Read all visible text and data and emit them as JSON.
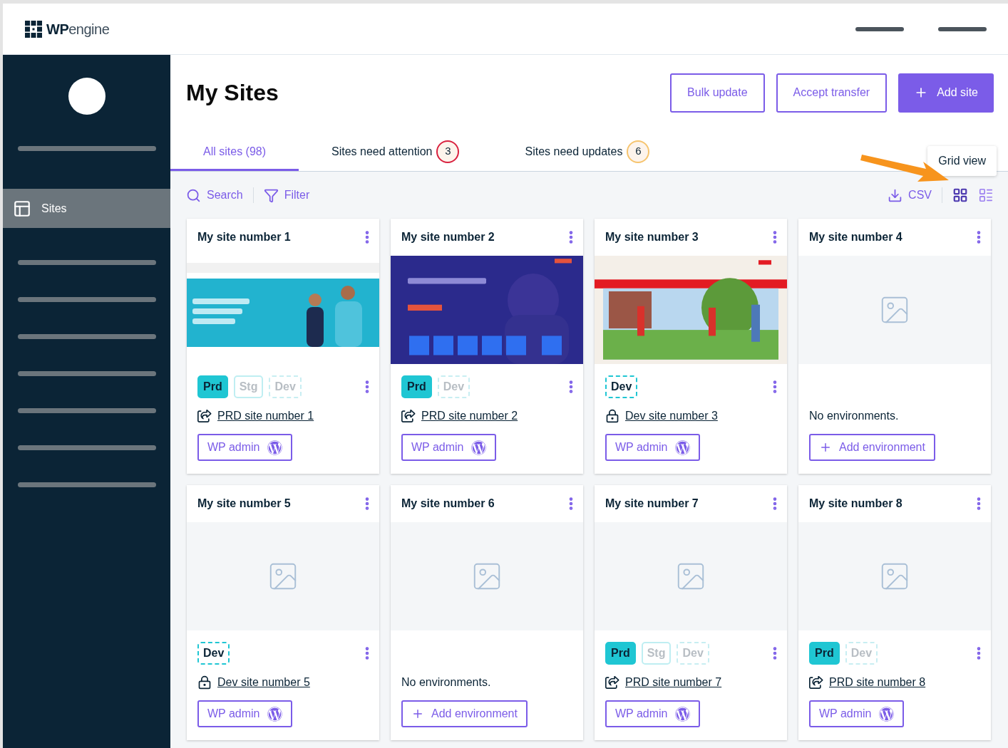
{
  "logo": {
    "bold": "WP",
    "light": "engine"
  },
  "sidebar": {
    "items": [
      {
        "label": "Sites",
        "selected": true
      }
    ]
  },
  "page_title": "My Sites",
  "header_buttons": [
    {
      "label": "Bulk update",
      "kind": "outline"
    },
    {
      "label": "Accept transfer",
      "kind": "outline"
    },
    {
      "label": "Add site",
      "kind": "primary"
    }
  ],
  "tabs": [
    {
      "label": "All sites (98)",
      "selected": true
    },
    {
      "label": "Sites need attention",
      "badge": "3",
      "color": "#d9213f",
      "selected": false
    },
    {
      "label": "Sites need updates",
      "badge": "6",
      "color": "#f6c46e",
      "selected": false
    }
  ],
  "toolbar": {
    "search": "Search",
    "filter": "Filter",
    "export": "CSV",
    "views": [
      {
        "kind": "grid",
        "selected": true
      },
      {
        "kind": "list",
        "selected": false
      }
    ],
    "tooltip": "Grid view"
  },
  "cards": [
    {
      "title": "My site number 1",
      "thumbnail": {
        "kind": "picture"
      },
      "environments": [
        {
          "label": "Prd",
          "kind": "prd",
          "selected": true
        },
        {
          "label": "Stg",
          "kind": "stg",
          "selected": false
        },
        {
          "label": "Dev",
          "kind": "dev",
          "selected": false
        }
      ],
      "link": {
        "text": "PRD site number 1",
        "kind": "share"
      },
      "action": {
        "label": "WP admin",
        "kind": "wp"
      }
    },
    {
      "title": "My site number 2",
      "thumbnail": {
        "kind": "picture"
      },
      "environments": [
        {
          "label": "Prd",
          "kind": "prd",
          "selected": true
        },
        {
          "label": "Dev",
          "kind": "dev",
          "selected": false
        }
      ],
      "link": {
        "text": "PRD site number 2",
        "kind": "share"
      },
      "action": {
        "label": "WP admin",
        "kind": "wp"
      }
    },
    {
      "title": "My site number 3",
      "thumbnail": {
        "kind": "picture"
      },
      "environments": [
        {
          "label": "Dev",
          "kind": "dev",
          "selected": true
        }
      ],
      "link": {
        "text": "Dev site number 3",
        "kind": "lock"
      },
      "action": {
        "label": "WP admin",
        "kind": "wp"
      }
    },
    {
      "title": "My site number 4",
      "thumbnail": {
        "kind": "placeholder"
      },
      "empty": "No environments.",
      "action": {
        "label": "Add environment",
        "kind": "add"
      }
    },
    {
      "title": "My site number 5",
      "thumbnail": {
        "kind": "placeholder"
      },
      "environments": [
        {
          "label": "Dev",
          "kind": "dev",
          "selected": true
        }
      ],
      "link": {
        "text": "Dev site number 5",
        "kind": "lock"
      },
      "action": {
        "label": "WP admin",
        "kind": "wp"
      }
    },
    {
      "title": "My site number 6",
      "thumbnail": {
        "kind": "placeholder"
      },
      "empty": "No environments.",
      "action": {
        "label": "Add environment",
        "kind": "add"
      }
    },
    {
      "title": "My site number 7",
      "thumbnail": {
        "kind": "placeholder"
      },
      "environments": [
        {
          "label": "Prd",
          "kind": "prd",
          "selected": true
        },
        {
          "label": "Stg",
          "kind": "stg",
          "selected": false
        },
        {
          "label": "Dev",
          "kind": "dev",
          "selected": false
        }
      ],
      "link": {
        "text": "PRD site number 7",
        "kind": "share"
      },
      "action": {
        "label": "WP admin",
        "kind": "wp"
      }
    },
    {
      "title": "My site number 8",
      "thumbnail": {
        "kind": "placeholder"
      },
      "environments": [
        {
          "label": "Prd",
          "kind": "prd",
          "selected": true
        },
        {
          "label": "Dev",
          "kind": "dev",
          "selected": false
        }
      ],
      "link": {
        "text": "PRD site number 8",
        "kind": "share"
      },
      "action": {
        "label": "WP admin",
        "kind": "wp"
      }
    }
  ]
}
